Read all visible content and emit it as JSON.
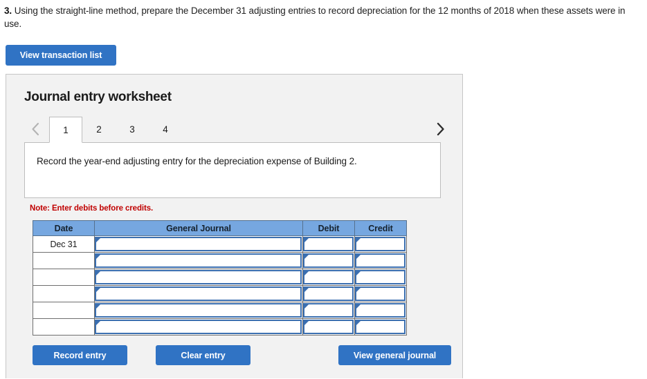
{
  "question": {
    "number": "3.",
    "text": " Using the straight-line method, prepare the December 31 adjusting entries to record depreciation for the 12 months of 2018 when these assets were in use."
  },
  "view_transaction_button": "View transaction list",
  "panel": {
    "title": "Journal entry worksheet",
    "prev_icon": "chevron-left-icon",
    "next_icon": "chevron-right-icon",
    "tabs": [
      {
        "label": "1",
        "active": true
      },
      {
        "label": "2",
        "active": false
      },
      {
        "label": "3",
        "active": false
      },
      {
        "label": "4",
        "active": false
      }
    ],
    "description": "Record the year-end adjusting entry for the depreciation expense of Building 2.",
    "note": "Note: Enter debits before credits.",
    "table": {
      "columns": [
        "Date",
        "General Journal",
        "Debit",
        "Credit"
      ],
      "rows": [
        {
          "date": "Dec 31",
          "general_journal": "",
          "debit": "",
          "credit": ""
        },
        {
          "date": "",
          "general_journal": "",
          "debit": "",
          "credit": ""
        },
        {
          "date": "",
          "general_journal": "",
          "debit": "",
          "credit": ""
        },
        {
          "date": "",
          "general_journal": "",
          "debit": "",
          "credit": ""
        },
        {
          "date": "",
          "general_journal": "",
          "debit": "",
          "credit": ""
        },
        {
          "date": "",
          "general_journal": "",
          "debit": "",
          "credit": ""
        }
      ]
    },
    "actions": {
      "record_entry": "Record entry",
      "clear_entry": "Clear entry",
      "view_general_journal": "View general journal"
    }
  },
  "colors": {
    "accent_blue": "#3073c4",
    "table_header_blue": "#76a7e0",
    "field_border_blue": "#3b6fb0",
    "note_red": "#c00000",
    "panel_bg": "#f2f2f2"
  }
}
